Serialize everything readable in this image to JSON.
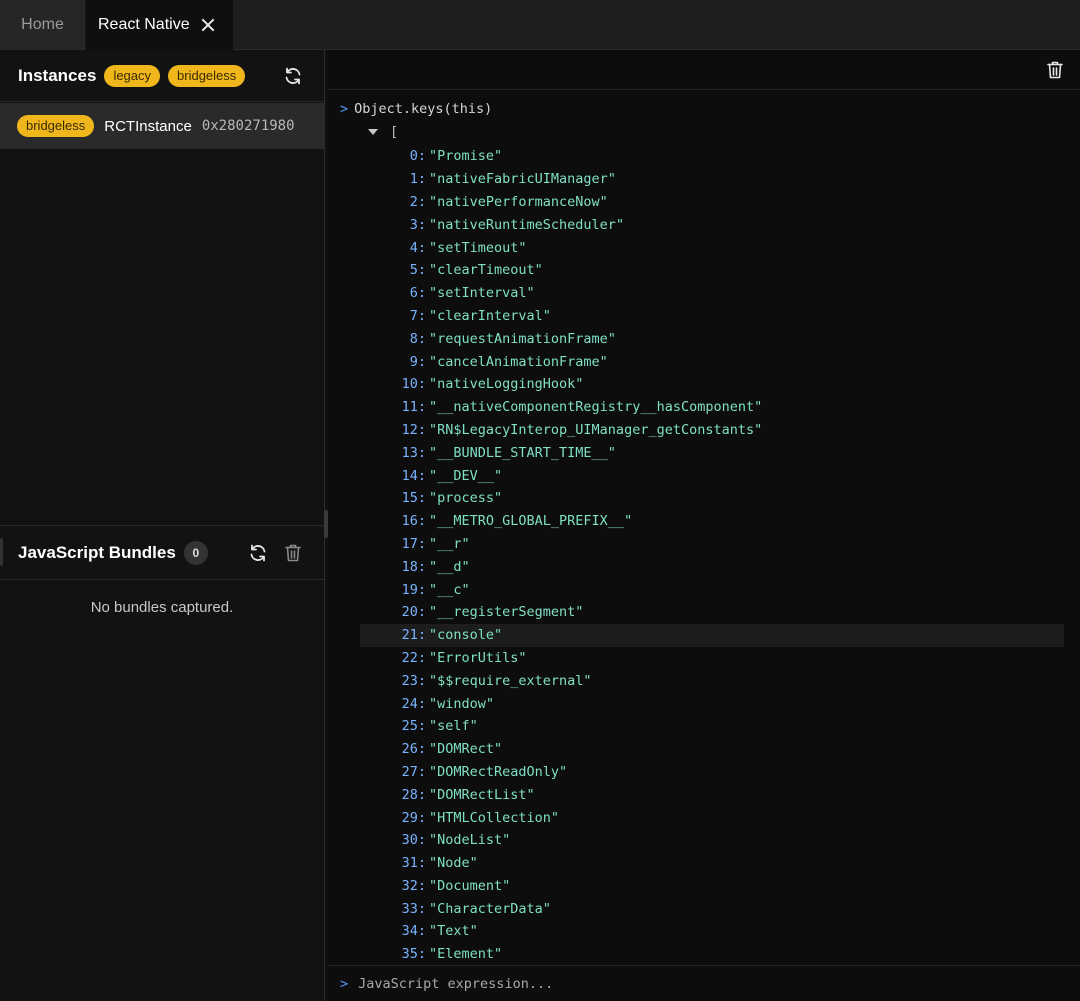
{
  "tabs": [
    {
      "label": "Home"
    },
    {
      "label": "React Native"
    }
  ],
  "instances": {
    "title": "Instances",
    "badges": [
      "legacy",
      "bridgeless"
    ],
    "rows": [
      {
        "badge": "bridgeless",
        "name": "RCTInstance",
        "address": "0x280271980"
      }
    ]
  },
  "bundles": {
    "title": "JavaScript Bundles",
    "count": "0",
    "empty_text": "No bundles captured."
  },
  "console": {
    "prompt": ">",
    "command": "Object.keys(this)",
    "array_open": "[",
    "highlighted_index": 21,
    "entries": [
      {
        "index": "0:",
        "value": "\"Promise\""
      },
      {
        "index": "1:",
        "value": "\"nativeFabricUIManager\""
      },
      {
        "index": "2:",
        "value": "\"nativePerformanceNow\""
      },
      {
        "index": "3:",
        "value": "\"nativeRuntimeScheduler\""
      },
      {
        "index": "4:",
        "value": "\"setTimeout\""
      },
      {
        "index": "5:",
        "value": "\"clearTimeout\""
      },
      {
        "index": "6:",
        "value": "\"setInterval\""
      },
      {
        "index": "7:",
        "value": "\"clearInterval\""
      },
      {
        "index": "8:",
        "value": "\"requestAnimationFrame\""
      },
      {
        "index": "9:",
        "value": "\"cancelAnimationFrame\""
      },
      {
        "index": "10:",
        "value": "\"nativeLoggingHook\""
      },
      {
        "index": "11:",
        "value": "\"__nativeComponentRegistry__hasComponent\""
      },
      {
        "index": "12:",
        "value": "\"RN$LegacyInterop_UIManager_getConstants\""
      },
      {
        "index": "13:",
        "value": "\"__BUNDLE_START_TIME__\""
      },
      {
        "index": "14:",
        "value": "\"__DEV__\""
      },
      {
        "index": "15:",
        "value": "\"process\""
      },
      {
        "index": "16:",
        "value": "\"__METRO_GLOBAL_PREFIX__\""
      },
      {
        "index": "17:",
        "value": "\"__r\""
      },
      {
        "index": "18:",
        "value": "\"__d\""
      },
      {
        "index": "19:",
        "value": "\"__c\""
      },
      {
        "index": "20:",
        "value": "\"__registerSegment\""
      },
      {
        "index": "21:",
        "value": "\"console\""
      },
      {
        "index": "22:",
        "value": "\"ErrorUtils\""
      },
      {
        "index": "23:",
        "value": "\"$$require_external\""
      },
      {
        "index": "24:",
        "value": "\"window\""
      },
      {
        "index": "25:",
        "value": "\"self\""
      },
      {
        "index": "26:",
        "value": "\"DOMRect\""
      },
      {
        "index": "27:",
        "value": "\"DOMRectReadOnly\""
      },
      {
        "index": "28:",
        "value": "\"DOMRectList\""
      },
      {
        "index": "29:",
        "value": "\"HTMLCollection\""
      },
      {
        "index": "30:",
        "value": "\"NodeList\""
      },
      {
        "index": "31:",
        "value": "\"Node\""
      },
      {
        "index": "32:",
        "value": "\"Document\""
      },
      {
        "index": "33:",
        "value": "\"CharacterData\""
      },
      {
        "index": "34:",
        "value": "\"Text\""
      },
      {
        "index": "35:",
        "value": "\"Element\""
      }
    ],
    "input_placeholder": "JavaScript expression..."
  },
  "icons": {
    "close": "close-icon",
    "refresh": "refresh-icon",
    "trash": "trash-icon",
    "expand": "chevron-down-icon"
  },
  "colors": {
    "badge": "#f0b71d",
    "index": "#7ab3ff",
    "string_value": "#7fe0c5",
    "prompt": "#4e9cf5"
  }
}
